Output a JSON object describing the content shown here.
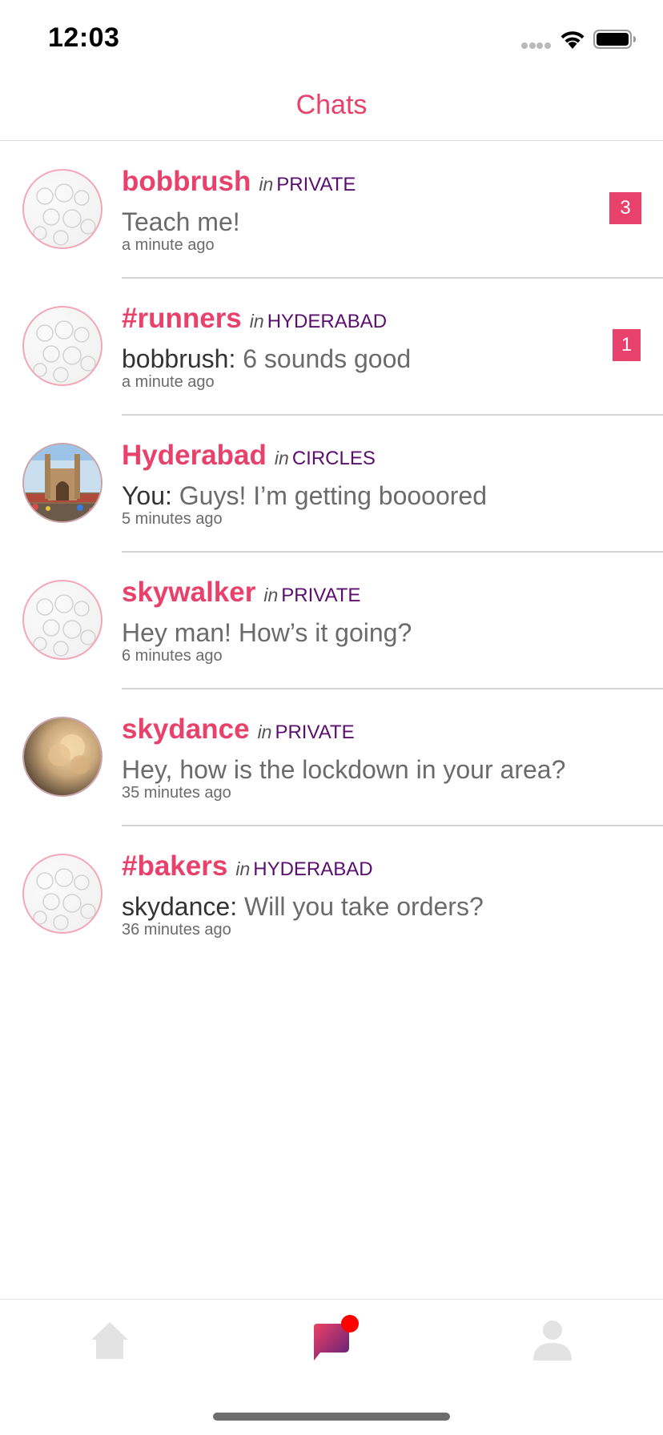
{
  "status_bar": {
    "time": "12:03"
  },
  "header": {
    "title": "Chats"
  },
  "chats": [
    {
      "name": "bobbrush",
      "in_word": "in",
      "room": "PRIVATE",
      "sender": "",
      "message": "Teach me!",
      "time": "a minute ago",
      "badge": "3",
      "avatar": "default-avatar"
    },
    {
      "name": "#runners",
      "in_word": "in",
      "room": "HYDERABAD",
      "sender": "bobbrush:",
      "message": " 6 sounds good",
      "time": "a minute ago",
      "badge": "1",
      "avatar": "default-avatar"
    },
    {
      "name": "Hyderabad",
      "in_word": "in",
      "room": "CIRCLES",
      "sender": "You:",
      "message": " Guys! I’m getting boooored",
      "time": "5 minutes ago",
      "badge": "",
      "avatar": "charminar-photo"
    },
    {
      "name": "skywalker",
      "in_word": "in",
      "room": "PRIVATE",
      "sender": "",
      "message": "Hey man! How’s it going?",
      "time": "6 minutes ago",
      "badge": "",
      "avatar": "default-avatar"
    },
    {
      "name": "skydance",
      "in_word": "in",
      "room": "PRIVATE",
      "sender": "",
      "message": "Hey, how is the lockdown in your area?",
      "time": "35 minutes ago",
      "badge": "",
      "avatar": "cloud-photo"
    },
    {
      "name": "#bakers",
      "in_word": "in",
      "room": "HYDERABAD",
      "sender": "skydance:",
      "message": " Will you take orders?",
      "time": "36 minutes ago",
      "badge": "",
      "avatar": "default-avatar"
    }
  ],
  "tab_bar": {
    "tabs": [
      {
        "icon": "home-icon",
        "active": false
      },
      {
        "icon": "chat-bubble-icon",
        "active": true,
        "has_notification_dot": true
      },
      {
        "icon": "profile-icon",
        "active": false
      }
    ]
  },
  "colors": {
    "accent": "#e8416b",
    "room": "#5a0e6e",
    "notification_dot": "#ff0000",
    "inactive_icon": "#e3e3e3"
  }
}
